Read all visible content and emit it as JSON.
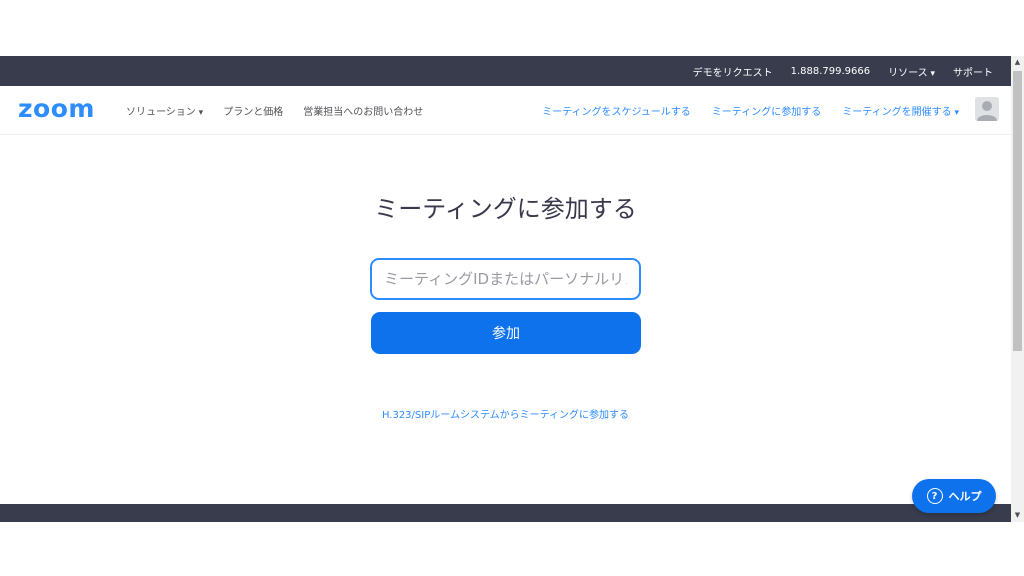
{
  "topbar": {
    "request_demo": "デモをリクエスト",
    "phone": "1.888.799.9666",
    "resources": "リソース",
    "support": "サポート"
  },
  "navbar": {
    "logo": "zoom",
    "solutions": "ソリューション",
    "plans_pricing": "プランと価格",
    "contact_sales": "営業担当へのお問い合わせ",
    "schedule_meeting": "ミーティングをスケジュールする",
    "join_meeting": "ミーティングに参加する",
    "host_meeting": "ミーティングを開催する"
  },
  "main": {
    "title": "ミーティングに参加する",
    "input_placeholder": "ミーティングIDまたはパーソナルリンク名",
    "join_button": "参加",
    "sip_link": "H.323/SIPルームシステムからミーティングに参加する"
  },
  "help": {
    "label": "ヘルプ",
    "icon": "question-circle-icon"
  },
  "colors": {
    "brand_blue": "#2d8cff",
    "button_blue": "#0e72ed",
    "dark_bar": "#383c4d"
  }
}
